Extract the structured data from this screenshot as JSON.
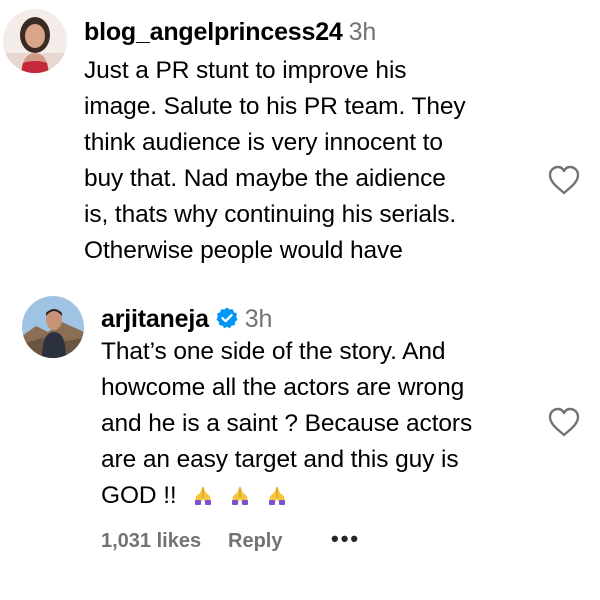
{
  "comments": [
    {
      "username": "blog_angelprincess24",
      "time": "3h",
      "avatar_icon": "user-avatar-photo",
      "lines": [
        "Just a PR stunt to improve his",
        "image. Salute to his PR team. They",
        "think audience is very innocent to",
        "buy that. Nad maybe the aidience",
        "is, thats why continuing his serials.",
        "Otherwise people would have"
      ],
      "like_icon": "heart-outline-icon"
    },
    {
      "username": "arjitaneja",
      "time": "3h",
      "verified": true,
      "avatar_icon": "user-avatar-photo",
      "lines": [
        "That’s one side of the story. And",
        "howcome all the actors are wrong",
        "and he is a saint ? Because actors",
        "are an easy target and this guy is",
        "GOD !!"
      ],
      "emoji": "🙏 🙏 🙏",
      "likes": "1,031 likes",
      "reply": "Reply",
      "more": "•••",
      "like_icon": "heart-outline-icon"
    }
  ],
  "colors": {
    "verified_blue": "#0095f6",
    "secondary_text": "#737373",
    "emoji_purple": "#7b4fd6",
    "emoji_yellow": "#f5c53a"
  }
}
